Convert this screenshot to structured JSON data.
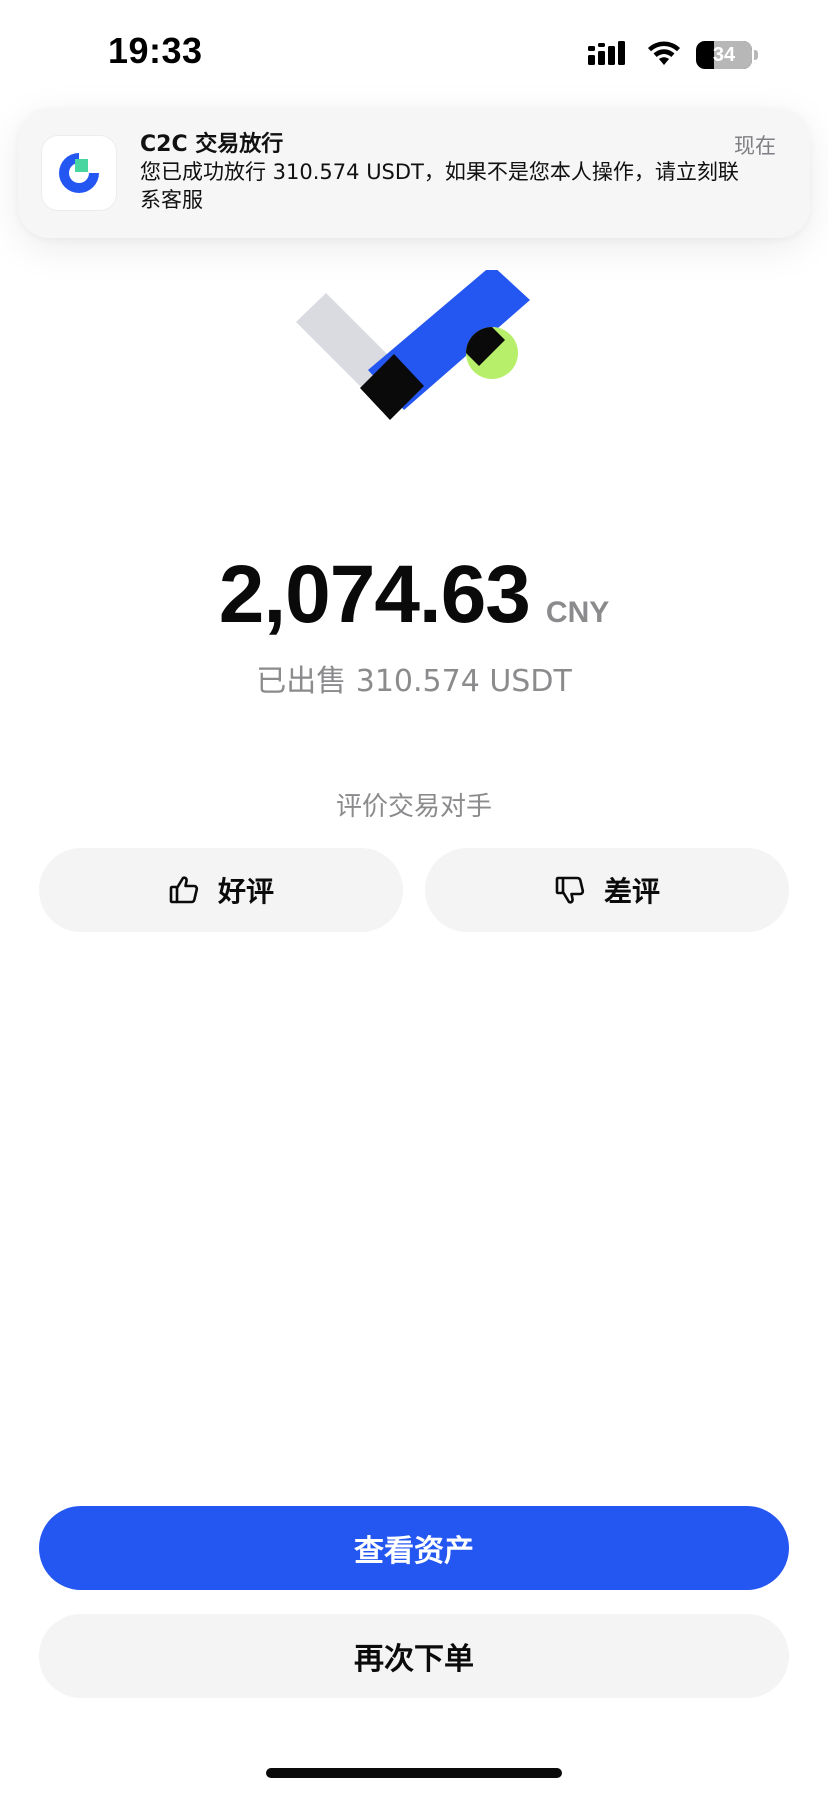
{
  "status_bar": {
    "time": "19:33",
    "battery_level": "34"
  },
  "notification": {
    "app_icon": "c2c-app-icon",
    "title": "C2C 交易放行",
    "body": "您已成功放行 310.574 USDT，如果不是您本人操作，请立刻联系客服",
    "time": "现在"
  },
  "success": {
    "icon": "success-check-icon",
    "amount": "2,074.63",
    "currency": "CNY",
    "sold_text": "已出售 310.574 USDT"
  },
  "rating": {
    "label": "评价交易对手",
    "good_label": "好评",
    "bad_label": "差评"
  },
  "actions": {
    "view_assets_label": "查看资产",
    "order_again_label": "再次下单"
  },
  "colors": {
    "accent": "#2456f2",
    "lime": "#b7ef6b",
    "muted_text": "#8b8b8e",
    "button_bg": "#f4f4f5"
  }
}
